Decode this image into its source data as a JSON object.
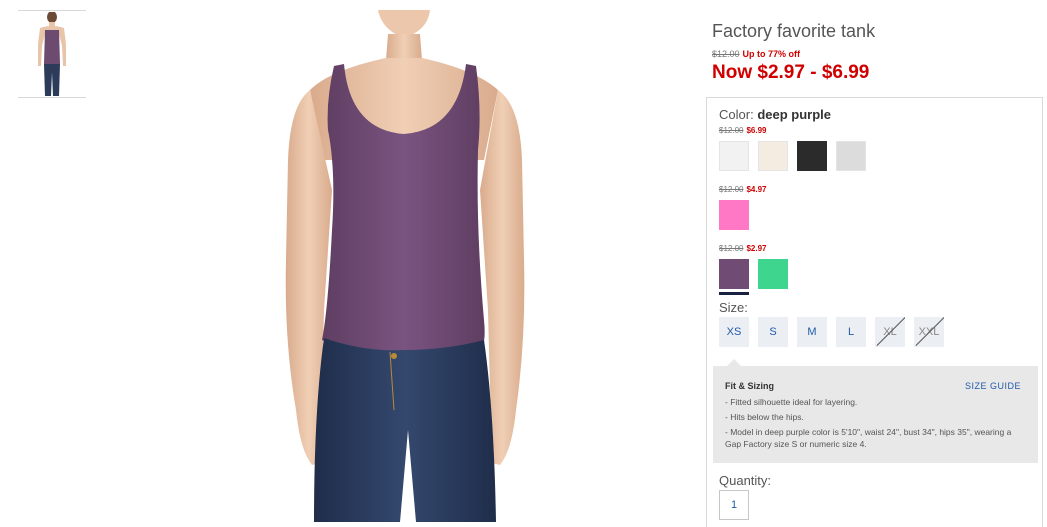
{
  "product": {
    "title": "Factory favorite tank",
    "original_price": "$12.00",
    "discount_text": "Up to 77% off",
    "now_price": "Now $2.97 - $6.99"
  },
  "color": {
    "label": "Color:",
    "selected": "deep purple",
    "tiers": [
      {
        "was": "$12.00",
        "now": "$6.99",
        "swatches": [
          "#f2f2f2",
          "#f4ece0",
          "#2b2b2b",
          "#dcdcdc"
        ]
      },
      {
        "was": "$12.00",
        "now": "$4.97",
        "swatches": [
          "#ff78c6"
        ]
      },
      {
        "was": "$12.00",
        "now": "$2.97",
        "swatches": [
          "#704b74",
          "#3ed58f"
        ]
      }
    ]
  },
  "size": {
    "label": "Size:",
    "options": [
      {
        "label": "XS",
        "available": true
      },
      {
        "label": "S",
        "available": true
      },
      {
        "label": "M",
        "available": true
      },
      {
        "label": "L",
        "available": true
      },
      {
        "label": "XL",
        "available": false
      },
      {
        "label": "XXL",
        "available": false
      }
    ]
  },
  "fit": {
    "title": "Fit & Sizing",
    "size_guide": "SIZE GUIDE",
    "bullets": [
      "- Fitted silhouette ideal for layering.",
      "- Hits below the hips.",
      "- Model in deep purple color is 5'10\", waist 24\", bust 34\", hips 35\", wearing a Gap Factory size S or numeric size 4."
    ]
  },
  "quantity": {
    "label": "Quantity:",
    "value": "1"
  }
}
